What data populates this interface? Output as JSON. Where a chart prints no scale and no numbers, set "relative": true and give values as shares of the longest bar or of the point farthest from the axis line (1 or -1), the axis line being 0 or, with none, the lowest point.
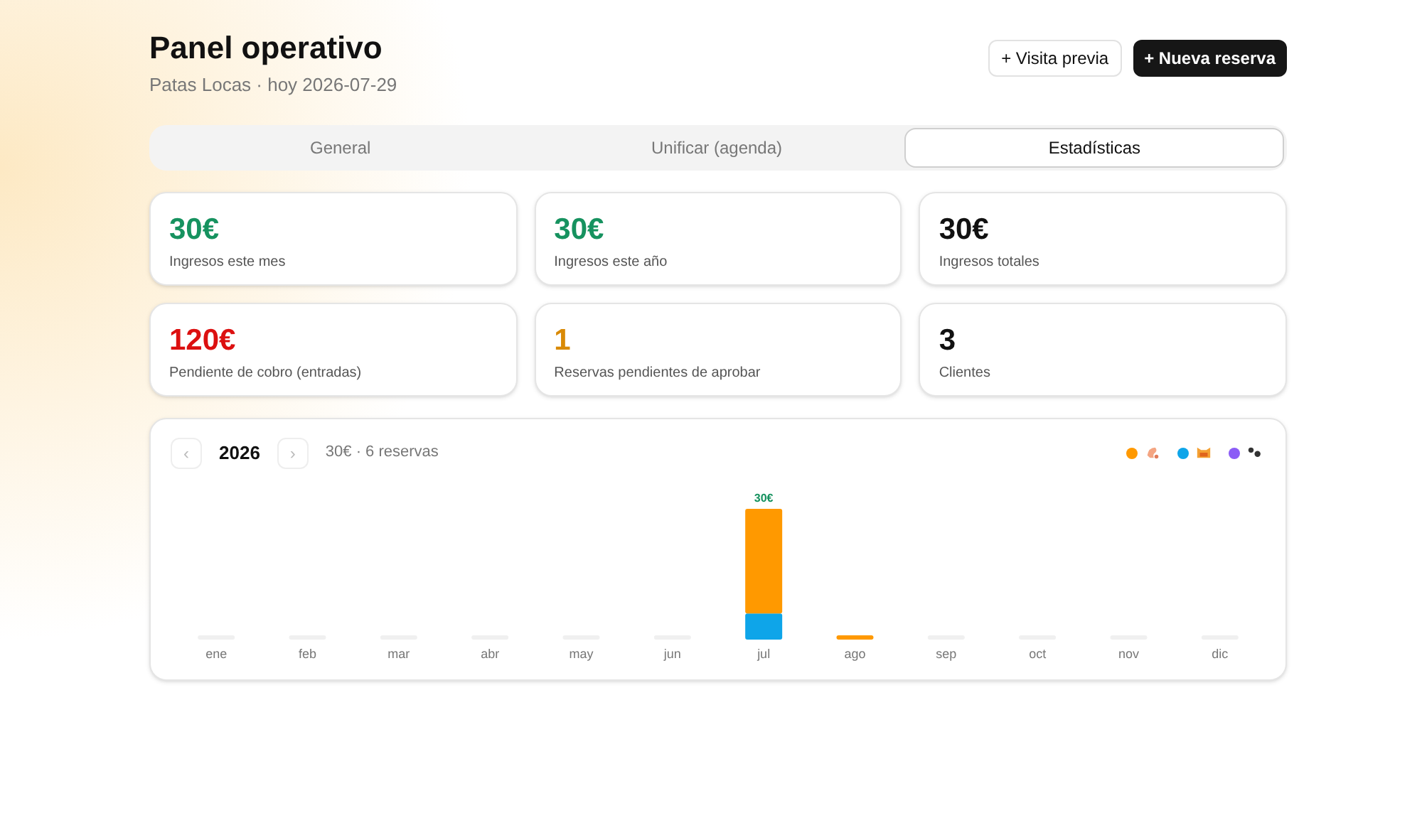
{
  "header": {
    "title": "Panel operativo",
    "subtitle": "Patas Locas · hoy 2026-07-29"
  },
  "actions": [
    {
      "label": "+ Visita previa",
      "kind": "secondary"
    },
    {
      "label": "+ Nueva reserva",
      "kind": "primary"
    }
  ],
  "tabs": [
    {
      "label": "General",
      "selected": false
    },
    {
      "label": "Unificar (agenda)",
      "selected": false
    },
    {
      "label": "Estadísticas",
      "selected": true
    }
  ],
  "stats": [
    {
      "value": "30€",
      "label": "Ingresos este mes",
      "color": "#16925f"
    },
    {
      "value": "30€",
      "label": "Ingresos este año",
      "color": "#16925f"
    },
    {
      "value": "30€",
      "label": "Ingresos totales",
      "color": "#111111"
    },
    {
      "value": "120€",
      "label": "Pendiente de cobro (entradas)",
      "color": "#dc1010"
    },
    {
      "value": "1",
      "label": "Reservas pendientes de aprobar",
      "color": "#d98a06"
    },
    {
      "value": "3",
      "label": "Clientes",
      "color": "#111111"
    }
  ],
  "chart": {
    "prev": "‹",
    "year": "2026",
    "next": "›",
    "summary": "30€ · 6 reservas",
    "legend": [
      {
        "color": "#ff9900"
      },
      {
        "color": "#0ea5e9"
      },
      {
        "color": "#8b5cf6"
      }
    ],
    "chart_data": {
      "type": "bar",
      "stacked": true,
      "relative": true,
      "categories": [
        "ene",
        "feb",
        "mar",
        "abr",
        "may",
        "jun",
        "jul",
        "ago",
        "sep",
        "oct",
        "nov",
        "dic"
      ],
      "series": [
        {
          "color": "#0ea5e9",
          "values": [
            null,
            null,
            null,
            null,
            null,
            null,
            0.2,
            null,
            null,
            null,
            null,
            null
          ]
        },
        {
          "color": "#ff9900",
          "values": [
            null,
            null,
            null,
            null,
            null,
            null,
            0.8,
            0.03,
            null,
            null,
            null,
            null
          ]
        }
      ],
      "value_labels": [
        null,
        null,
        null,
        null,
        null,
        null,
        "30€",
        null,
        null,
        null,
        null,
        null
      ]
    }
  }
}
